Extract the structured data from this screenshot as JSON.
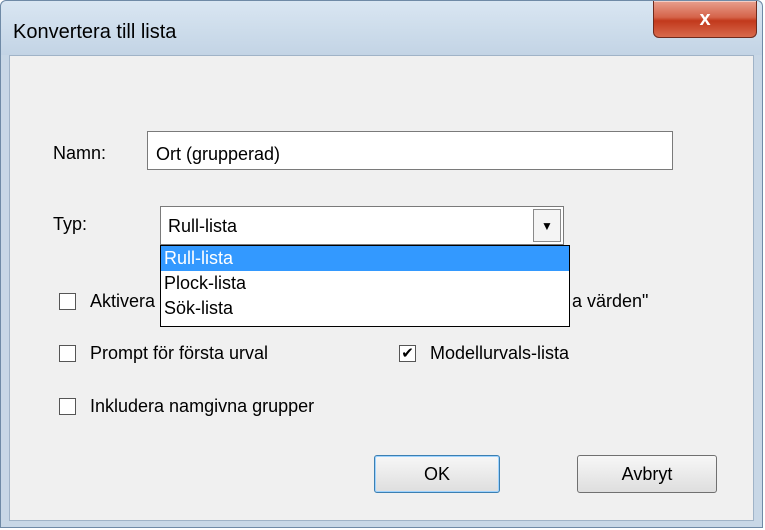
{
  "window": {
    "title": "Konvertera till lista",
    "close_label": "x"
  },
  "form": {
    "name_label": "Namn:",
    "name_value": "Ort (grupperad)",
    "type_label": "Typ:",
    "type_selected": "Rull-lista",
    "type_options": [
      "Rull-lista",
      "Plock-lista",
      "Sök-lista"
    ],
    "dropdown_arrow": "▼"
  },
  "checkboxes": {
    "activate": {
      "label_start": "Aktivera",
      "label_end": "a värden\"",
      "checked": false
    },
    "prompt_first": {
      "label": "Prompt för första urval",
      "checked": false
    },
    "model_list": {
      "label": "Modellurvals-lista",
      "checked": true,
      "mark": "✔"
    },
    "include_groups": {
      "label": "Inkludera namgivna grupper",
      "checked": false
    }
  },
  "buttons": {
    "ok": "OK",
    "cancel": "Avbryt"
  }
}
